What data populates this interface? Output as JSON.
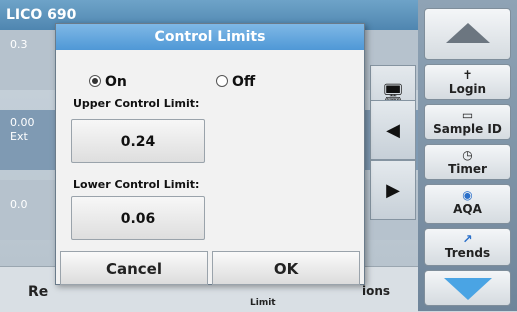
{
  "background": {
    "title": "LICO 690",
    "row_values": [
      "0.3",
      "0.00",
      "Ext",
      "0.0"
    ],
    "bottom_left": "Re",
    "bottom_mid": "Limit",
    "bottom_right": "ions"
  },
  "right_panel": {
    "login_label": "Login",
    "sample_id_label": "Sample ID",
    "timer_label": "Timer",
    "aqa_label": "AQA",
    "trends_label": "Trends"
  },
  "dialog": {
    "title": "Control Limits",
    "option_on": "On",
    "option_off": "Off",
    "selected": "On",
    "upper_label": "Upper Control Limit:",
    "upper_value": "0.24",
    "lower_label": "Lower Control Limit:",
    "lower_value": "0.06",
    "cancel_label": "Cancel",
    "ok_label": "OK"
  },
  "colors": {
    "header": "#4f98d6",
    "accent_down_arrow": "#4aa4e4"
  }
}
